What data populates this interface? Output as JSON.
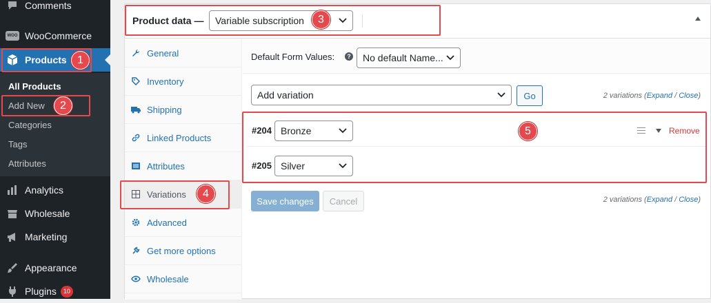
{
  "sidebar": {
    "comments": "Comments",
    "woocommerce": "WooCommerce",
    "woo_icon": "WOO",
    "products": "Products",
    "submenu": [
      "All Products",
      "Add New",
      "Categories",
      "Tags",
      "Attributes"
    ],
    "analytics": "Analytics",
    "wholesale": "Wholesale",
    "marketing": "Marketing",
    "appearance": "Appearance",
    "plugins": "Plugins",
    "plugins_badge": "10"
  },
  "callouts": [
    "1",
    "2",
    "3",
    "4",
    "5"
  ],
  "product_data": {
    "title": "Product data —",
    "type_value": "Variable subscription"
  },
  "tabs": [
    "General",
    "Inventory",
    "Shipping",
    "Linked Products",
    "Attributes",
    "Variations",
    "Advanced",
    "Get more options",
    "Wholesale"
  ],
  "active_tab": "Variations",
  "variations": {
    "default_label": "Default Form Values:",
    "help": "?",
    "default_value": "No default Name...",
    "add_value": "Add variation",
    "go": "Go",
    "count_text": "2 variations",
    "open_paren": "(",
    "expand": "Expand",
    "slash": " / ",
    "close": "Close",
    "close_paren": ")",
    "items": [
      {
        "id": "#204",
        "value": "Bronze"
      },
      {
        "id": "#205",
        "value": "Silver"
      }
    ],
    "remove": "Remove",
    "save": "Save changes",
    "cancel": "Cancel"
  },
  "colors": {
    "accent": "#2271b1",
    "sidebar_bg": "#1d2327",
    "callout": "#e5484d",
    "remove": "#d63638"
  }
}
